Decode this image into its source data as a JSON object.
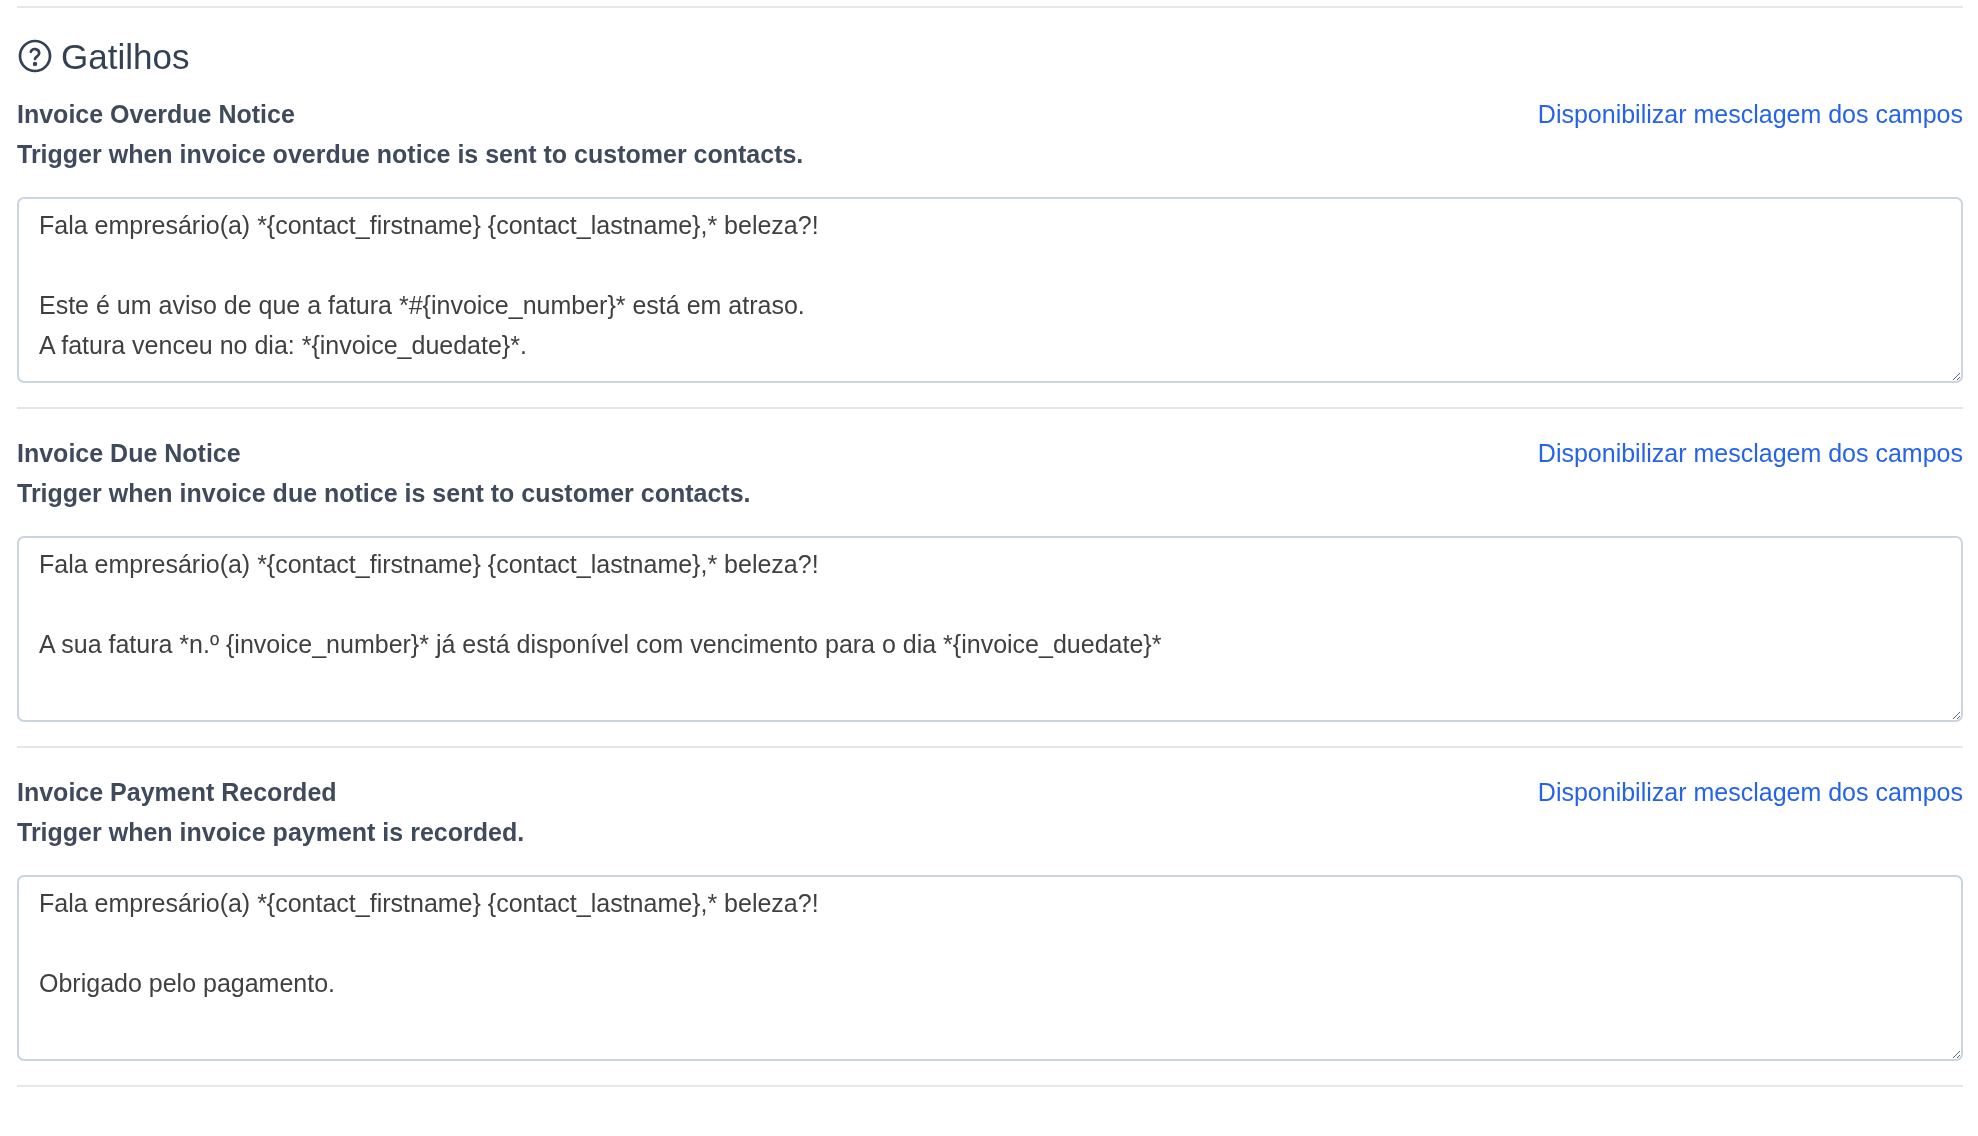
{
  "section_title": "Gatilhos",
  "triggers": [
    {
      "name": "Invoice Overdue Notice",
      "description": "Trigger when invoice overdue notice is sent to customer contacts.",
      "link": "Disponibilizar mesclagem dos campos",
      "message": "Fala empresário(a) *{contact_firstname} {contact_lastname},* beleza?!\n\nEste é um aviso de que a fatura *#{invoice_number}* está em atraso.\nA fatura venceu no dia: *{invoice_duedate}*."
    },
    {
      "name": "Invoice Due Notice",
      "description": "Trigger when invoice due notice is sent to customer contacts.",
      "link": "Disponibilizar mesclagem dos campos",
      "message": "Fala empresário(a) *{contact_firstname} {contact_lastname},* beleza?!\n\nA sua fatura *n.º {invoice_number}* já está disponível com vencimento para o dia *{invoice_duedate}*"
    },
    {
      "name": "Invoice Payment Recorded",
      "description": "Trigger when invoice payment is recorded.",
      "link": "Disponibilizar mesclagem dos campos",
      "message": "Fala empresário(a) *{contact_firstname} {contact_lastname},* beleza?!\n\nObrigado pelo pagamento."
    }
  ]
}
